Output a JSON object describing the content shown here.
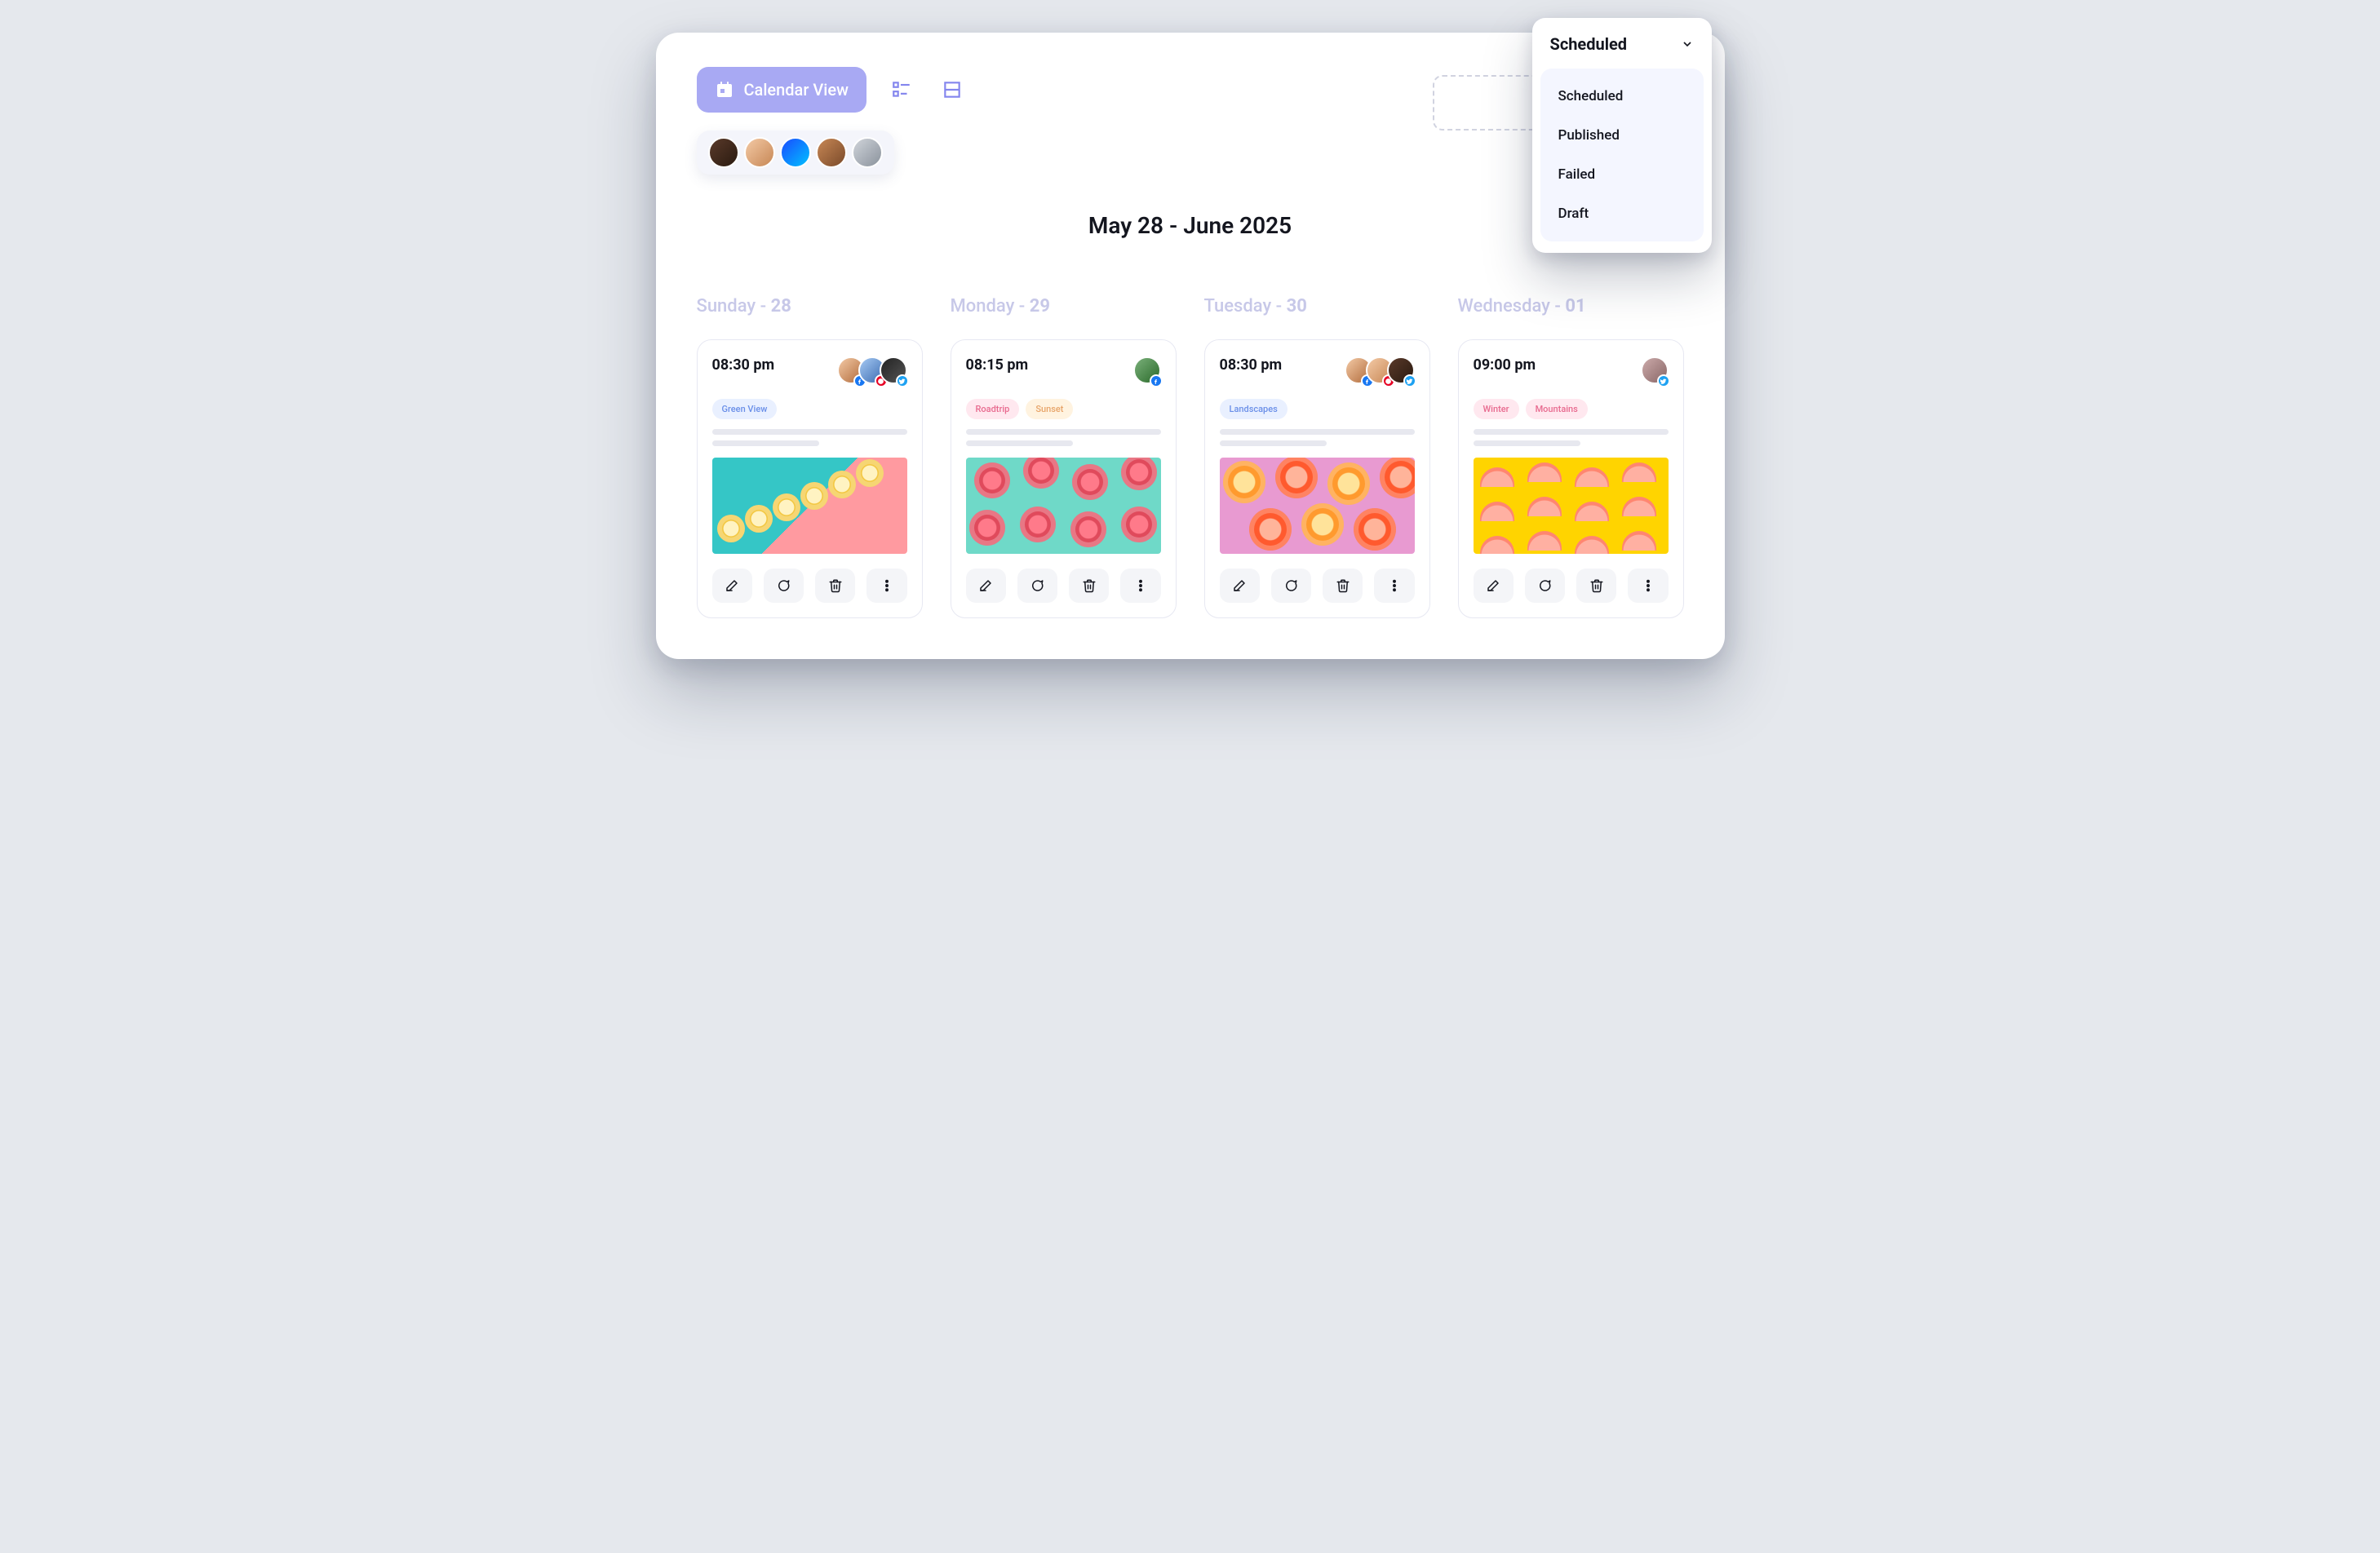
{
  "toolbar": {
    "calendar_view_label": "Calendar View"
  },
  "team_avatars": [
    {
      "name": "member-1"
    },
    {
      "name": "member-2"
    },
    {
      "name": "member-3"
    },
    {
      "name": "member-4"
    },
    {
      "name": "member-5"
    }
  ],
  "date_range_title": "May 28 - June 2025",
  "status_filter": {
    "selected": "Scheduled",
    "options": [
      "Scheduled",
      "Published",
      "Failed",
      "Draft"
    ]
  },
  "days": [
    {
      "weekday": "Sunday",
      "sep": " - ",
      "num": "28"
    },
    {
      "weekday": "Monday",
      "sep": " - ",
      "num": "29"
    },
    {
      "weekday": "Tuesday",
      "sep": " - ",
      "num": "30"
    },
    {
      "weekday": "Wednesday",
      "sep": " - ",
      "num": "01"
    }
  ],
  "cards": [
    {
      "time": "08:30 pm",
      "assignees": [
        {
          "network": "facebook"
        },
        {
          "network": "pinterest"
        },
        {
          "network": "twitter"
        }
      ],
      "tags": [
        {
          "label": "Green View",
          "tone": "blue"
        }
      ]
    },
    {
      "time": "08:15 pm",
      "assignees": [
        {
          "network": "facebook"
        }
      ],
      "tags": [
        {
          "label": "Roadtrip",
          "tone": "pink"
        },
        {
          "label": "Sunset",
          "tone": "orange"
        }
      ]
    },
    {
      "time": "08:30 pm",
      "assignees": [
        {
          "network": "facebook"
        },
        {
          "network": "pinterest"
        },
        {
          "network": "twitter"
        }
      ],
      "tags": [
        {
          "label": "Landscapes",
          "tone": "blue"
        }
      ]
    },
    {
      "time": "09:00 pm",
      "assignees": [
        {
          "network": "twitter"
        }
      ],
      "tags": [
        {
          "label": "Winter",
          "tone": "pink"
        },
        {
          "label": "Mountains",
          "tone": "pink"
        }
      ]
    }
  ]
}
